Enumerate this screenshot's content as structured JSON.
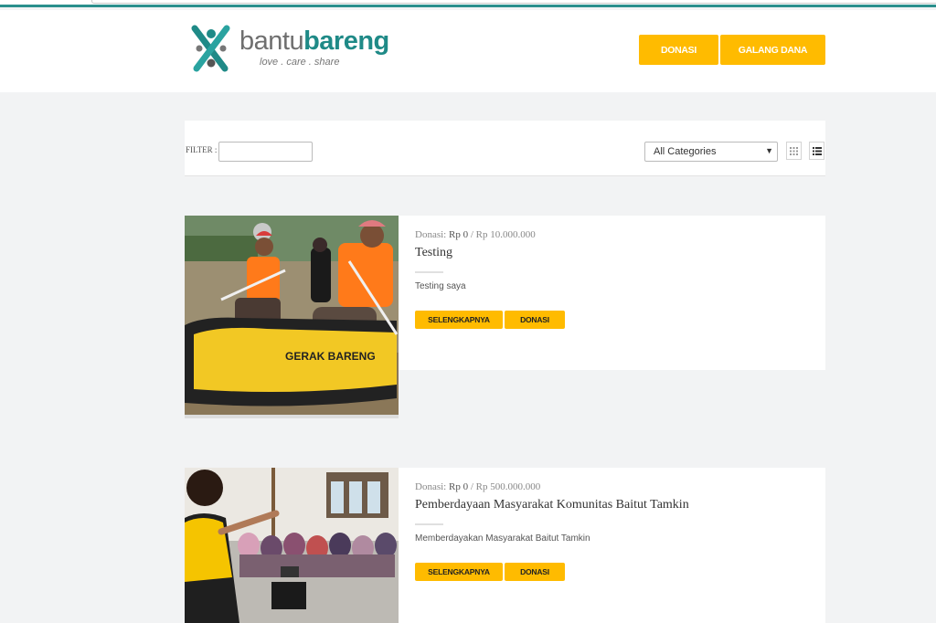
{
  "brand": {
    "name_part1": "bantu",
    "name_part2": "bareng",
    "tagline": "love . care . share",
    "logo_icon": "people-cross-logo-icon",
    "colors": {
      "primary": "#1f8a87",
      "accent": "#ffbb00"
    }
  },
  "nav": {
    "donasi_label": "DONASI",
    "galang_label": "GALANG DANA"
  },
  "filter": {
    "label": "FILTER :",
    "value": "",
    "category_selected": "All Categories",
    "grid_view_icon": "grid-view-icon",
    "list_view_icon": "list-view-icon"
  },
  "campaigns": [
    {
      "photo": "rafting-photo",
      "raft_text": "GERAK BARENG",
      "meta_prefix": "Donasi:",
      "collected": "Rp 0",
      "separator": "/",
      "target": "Rp  10.000.000",
      "title": "Testing",
      "description": "Testing saya",
      "more_label": "SELENGKAPNYA",
      "donate_label": "DONASI"
    },
    {
      "photo": "classroom-photo",
      "meta_prefix": "Donasi:",
      "collected": "Rp 0",
      "separator": "/",
      "target": "Rp  500.000.000",
      "title": "Pemberdayaan Masyarakat Komunitas Baitut Tamkin",
      "description": "Memberdayakan Masyarakat Baitut Tamkin",
      "more_label": "SELENGKAPNYA",
      "donate_label": "DONASI"
    }
  ]
}
